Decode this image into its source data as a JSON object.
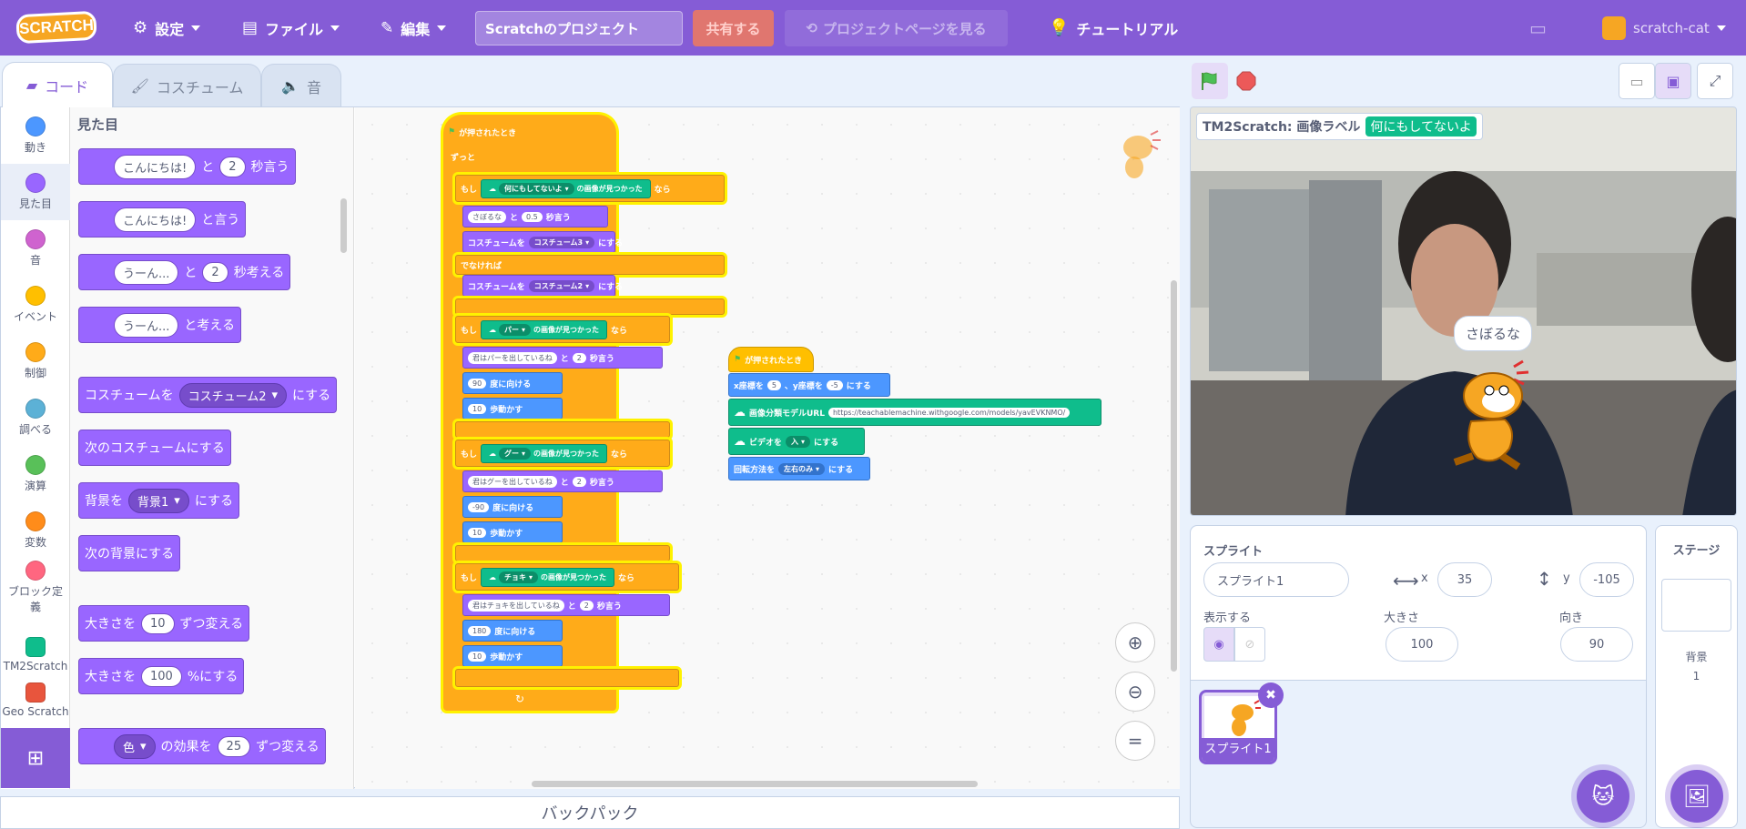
{
  "menubar": {
    "logo": "SCRATCH",
    "settings": "設定",
    "file": "ファイル",
    "edit": "編集",
    "project_title": "Scratchのプロジェクト",
    "share": "共有する",
    "project_page": "プロジェクトページを見る",
    "tutorials": "チュートリアル",
    "username": "scratch-cat"
  },
  "tabs": {
    "code": "コード",
    "costumes": "コスチューム",
    "sounds": "音"
  },
  "categories": [
    {
      "label": "動き",
      "color": "#4c97ff"
    },
    {
      "label": "見た目",
      "color": "#9966ff"
    },
    {
      "label": "音",
      "color": "#cf63cf"
    },
    {
      "label": "イベント",
      "color": "#ffbf00"
    },
    {
      "label": "制御",
      "color": "#ffab19"
    },
    {
      "label": "調べる",
      "color": "#5cb1d6"
    },
    {
      "label": "演算",
      "color": "#59c059"
    },
    {
      "label": "変数",
      "color": "#ff8c1a"
    },
    {
      "label": "ブロック定義",
      "color": "#ff6680"
    },
    {
      "label": "TM2Scratch",
      "color": "#0fbd8c"
    },
    {
      "label": "Geo Scratch",
      "color": "#e8553d"
    }
  ],
  "palette": {
    "heading": "見た目",
    "b1": {
      "text1": "こんにちは!",
      "mid": "と",
      "num": "2",
      "end": "秒言う"
    },
    "b2": {
      "text1": "こんにちは!",
      "end": "と言う"
    },
    "b3": {
      "text1": "うーん...",
      "mid": "と",
      "num": "2",
      "end": "秒考える"
    },
    "b4": {
      "text1": "うーん...",
      "end": "と考える"
    },
    "b5": {
      "pre": "コスチュームを",
      "dd": "コスチューム2",
      "end": "にする"
    },
    "b6": "次のコスチュームにする",
    "b7": {
      "pre": "背景を",
      "dd": "背景1",
      "end": "にする"
    },
    "b8": "次の背景にする",
    "b9": {
      "pre": "大きさを",
      "num": "10",
      "end": "ずつ変える"
    },
    "b10": {
      "pre": "大きさを",
      "num": "100",
      "end": "%にする"
    },
    "b11": {
      "dd": "色",
      "mid": "の効果を",
      "num": "25",
      "end": "ずつ変える"
    }
  },
  "script1": {
    "hat": "が押されたとき",
    "forever": "ずっと",
    "if": "もし",
    "then": "なら",
    "else": "でなければ",
    "found": "の画像が見つかった",
    "if1": {
      "label": "何にもしてないよ"
    },
    "say1": {
      "text": "さぼるな",
      "mid": "と",
      "num": "0.5",
      "end": "秒言う"
    },
    "cost3": {
      "pre": "コスチュームを",
      "dd": "コスチューム3",
      "end": "にする"
    },
    "cost2": {
      "pre": "コスチュームを",
      "dd": "コスチューム2",
      "end": "にする"
    },
    "if2": {
      "label": "パー"
    },
    "say2": {
      "text": "君はパーを出しているね",
      "mid": "と",
      "num": "2",
      "end": "秒言う"
    },
    "dir2": {
      "num": "90",
      "end": "度に向ける"
    },
    "mv2": {
      "num": "10",
      "end": "歩動かす"
    },
    "if3": {
      "label": "グー"
    },
    "say3": {
      "text": "君はグーを出しているね",
      "mid": "と",
      "num": "2",
      "end": "秒言う"
    },
    "dir3": {
      "num": "-90",
      "end": "度に向ける"
    },
    "mv3": {
      "num": "10",
      "end": "歩動かす"
    },
    "if4": {
      "label": "チョキ"
    },
    "say4": {
      "text": "君はチョキを出しているね",
      "mid": "と",
      "num": "2",
      "end": "秒言う"
    },
    "dir4": {
      "num": "180",
      "end": "度に向ける"
    },
    "mv4": {
      "num": "10",
      "end": "歩動かす"
    }
  },
  "script2": {
    "hat": "が押されたとき",
    "goto": {
      "pre": "x座標を",
      "x": "5",
      "mid": "、y座標を",
      "y": "-5",
      "end": "にする"
    },
    "model": {
      "pre": "画像分類モデルURL",
      "url": "https://teachablemachine.withgoogle.com/models/yavEVKNMO/"
    },
    "video": {
      "pre": "ビデオを",
      "dd": "入",
      "end": "にする"
    },
    "rot": {
      "pre": "回転方法を",
      "dd": "左右のみ",
      "end": "にする"
    }
  },
  "backpack": "バックパック",
  "stage": {
    "monitor_label": "TM2Scratch: 画像ラベル",
    "monitor_value": "何にもしてないよ",
    "speech": "さぼるな"
  },
  "sprite_info": {
    "sprite_label": "スプライト",
    "name": "スプライト1",
    "x_label": "x",
    "x": "35",
    "y_label": "y",
    "y": "-105",
    "show_label": "表示する",
    "size_label": "大きさ",
    "size": "100",
    "direction_label": "向き",
    "direction": "90",
    "thumb_name": "スプライト1"
  },
  "stage_panel": {
    "title": "ステージ",
    "backdrop_label": "背景",
    "backdrop_count": "1"
  }
}
